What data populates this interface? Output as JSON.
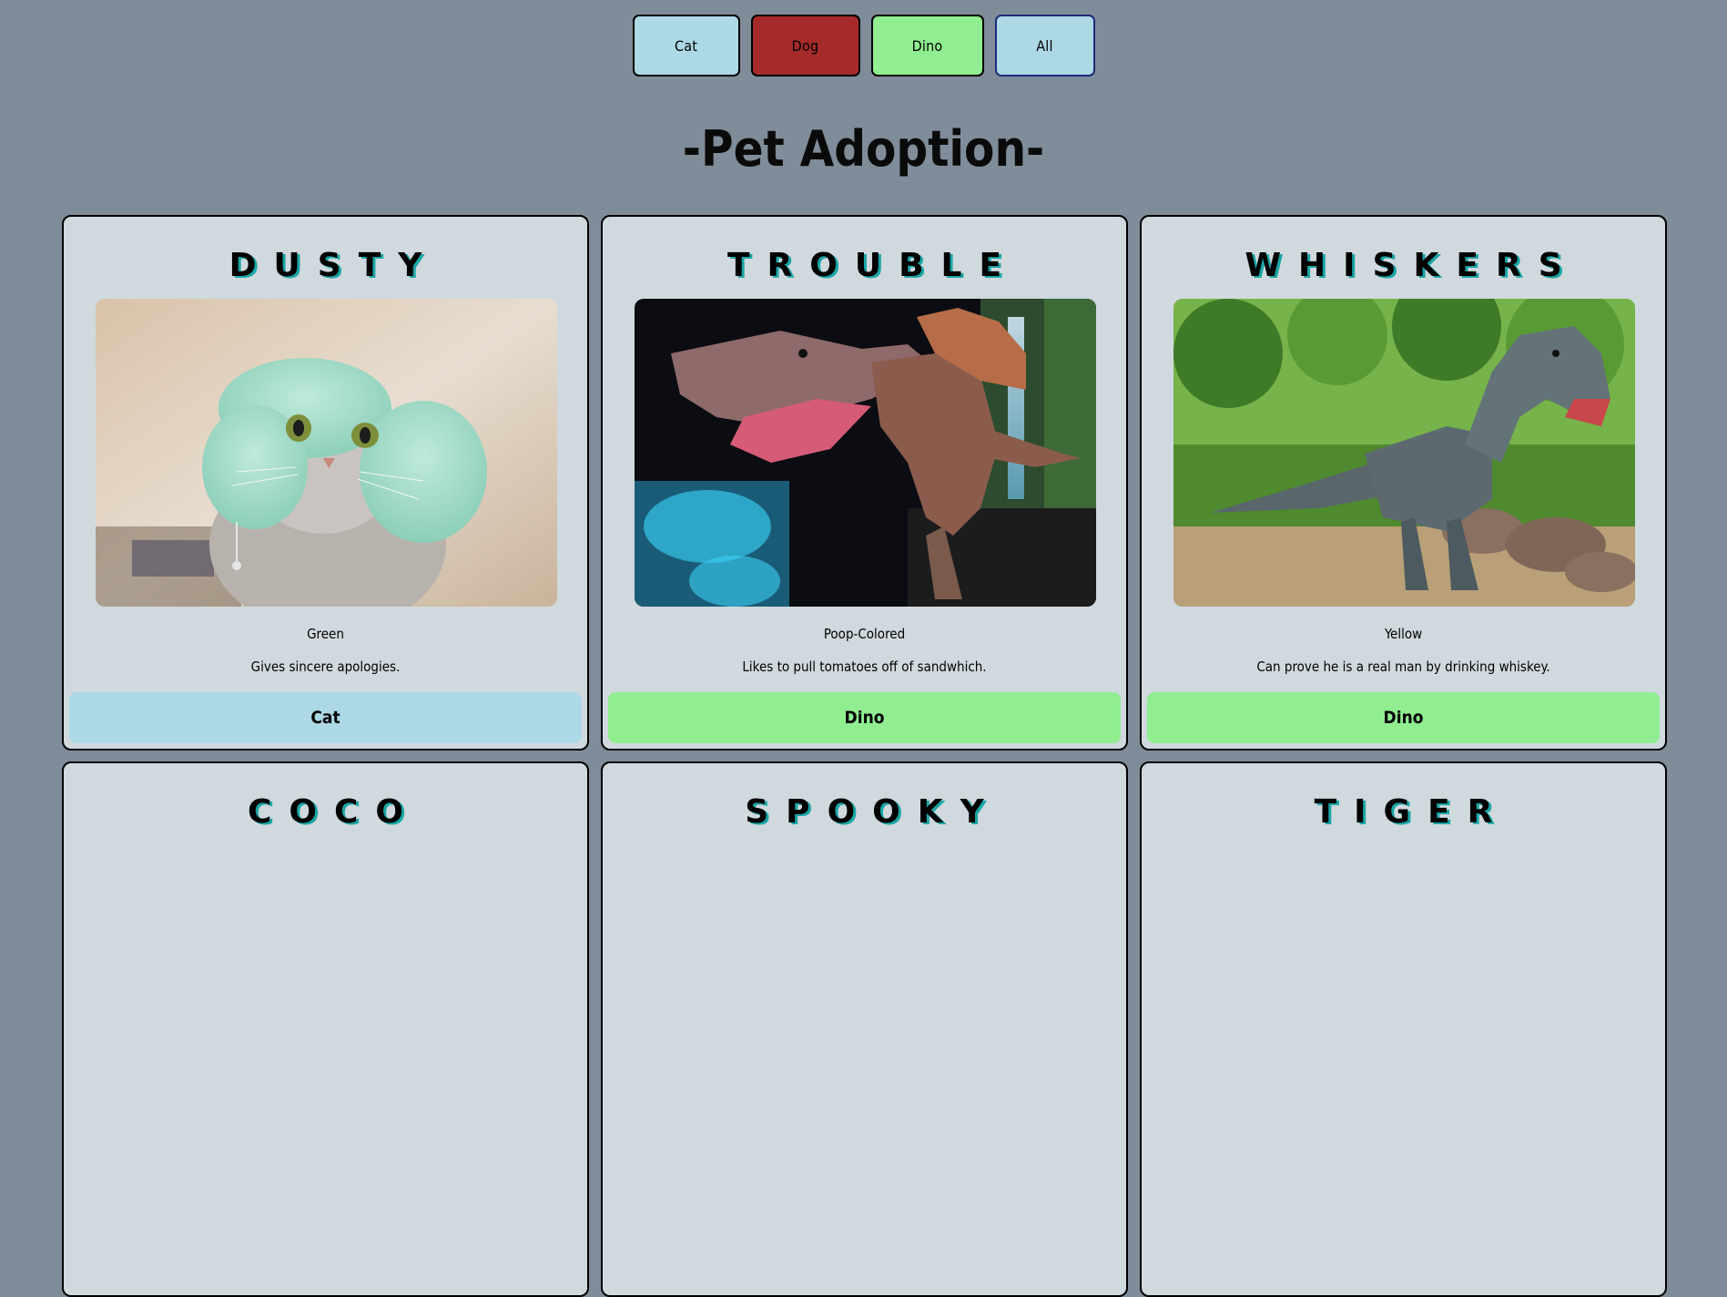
{
  "colors": {
    "background": "#7f8c99",
    "card": "#d0d9de",
    "cat": "#add8e6",
    "dog": "#a52a2a",
    "dino": "#90ee90",
    "all": "#add8e6",
    "name_shadow": "#1aa6a6"
  },
  "filters": {
    "cat": "Cat",
    "dog": "Dog",
    "dino": "Dino",
    "all": "All"
  },
  "header": {
    "title": "-Pet Adoption-"
  },
  "pets": [
    {
      "name": "DUSTY",
      "image_icon": "cat-photo",
      "color": "Green",
      "description": "Gives sincere apologies.",
      "type": "Cat"
    },
    {
      "name": "TROUBLE",
      "image_icon": "dinosaur-photo",
      "color": "Poop-Colored",
      "description": "Likes to pull tomatoes off of sandwhich.",
      "type": "Dino"
    },
    {
      "name": "WHISKERS",
      "image_icon": "dinosaur-photo",
      "color": "Yellow",
      "description": "Can prove he is a real man by drinking whiskey.",
      "type": "Dino"
    },
    {
      "name": "COCO"
    },
    {
      "name": "SPOOKY"
    },
    {
      "name": "TIGER"
    }
  ]
}
